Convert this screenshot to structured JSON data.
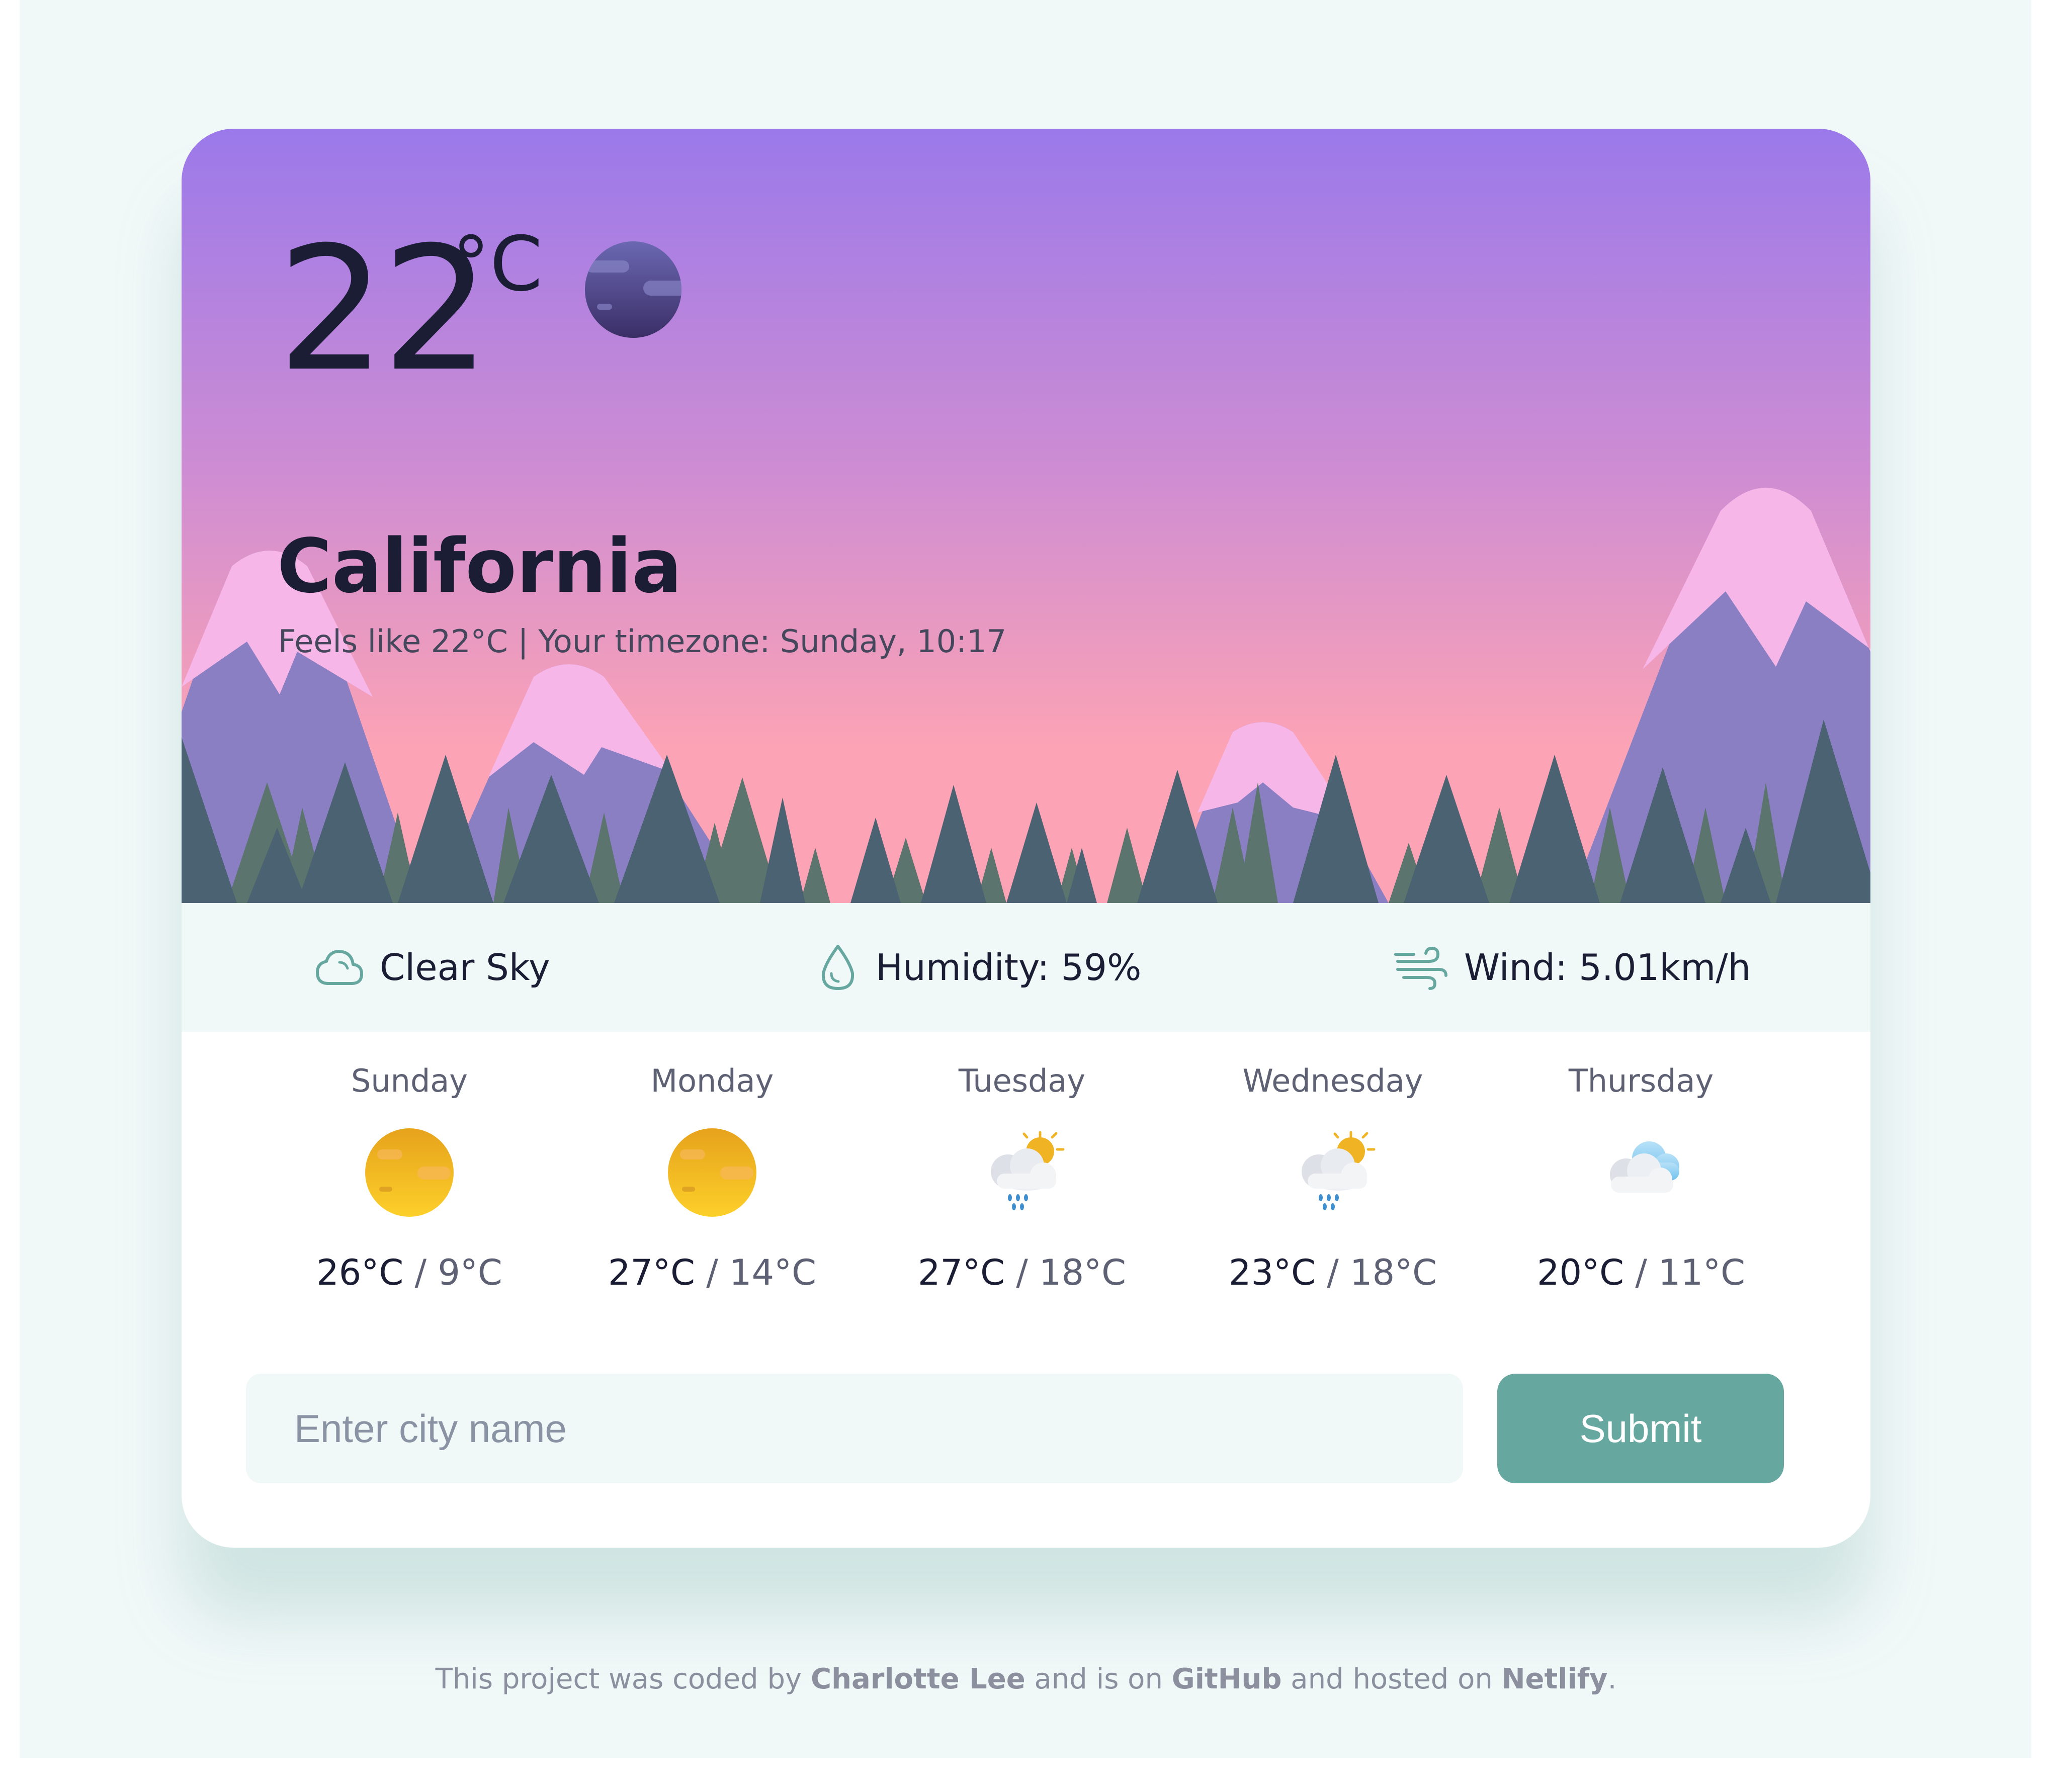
{
  "weather": {
    "temperature": "22",
    "unit": "°C",
    "city": "California",
    "subtitle": "Feels like 22°C | Your timezone: Sunday, 10:17",
    "current_icon": "night-moon-icon"
  },
  "stats": {
    "condition": {
      "icon": "cloud-icon",
      "text": "Clear Sky"
    },
    "humidity": {
      "icon": "water-drop-icon",
      "text": "Humidity: 59%"
    },
    "wind": {
      "icon": "wind-icon",
      "text": "Wind: 5.01km/h"
    }
  },
  "forecast": [
    {
      "day": "Sunday",
      "high": "26°C",
      "low": "9°C",
      "icon": "sun-icon"
    },
    {
      "day": "Monday",
      "high": "27°C",
      "low": "14°C",
      "icon": "sun-icon"
    },
    {
      "day": "Tuesday",
      "high": "27°C",
      "low": "18°C",
      "icon": "sun-cloud-rain-icon"
    },
    {
      "day": "Wednesday",
      "high": "23°C",
      "low": "18°C",
      "icon": "sun-cloud-rain-icon"
    },
    {
      "day": "Thursday",
      "high": "20°C",
      "low": "11°C",
      "icon": "cloudy-icon"
    }
  ],
  "temp_separator": " / ",
  "search": {
    "placeholder": "Enter city name",
    "submit_label": "Submit"
  },
  "footer": {
    "text_1": "This project was coded by ",
    "author": "Charlotte Lee",
    "text_2": " and is on ",
    "repo": "GitHub",
    "text_3": " and hosted on ",
    "host": "Netlify",
    "text_4": "."
  },
  "colors": {
    "sky_top": "#9b79ea",
    "sky_bottom": "#fca3b5",
    "snow": "#f7b6e8",
    "mountain": "#8b7fc4",
    "tree_dark": "#4b6272",
    "tree_green": "#5b746d",
    "accent": "#66a8a0",
    "panel_bg": "#f1f8f8",
    "text_dark": "#1b1d35"
  }
}
